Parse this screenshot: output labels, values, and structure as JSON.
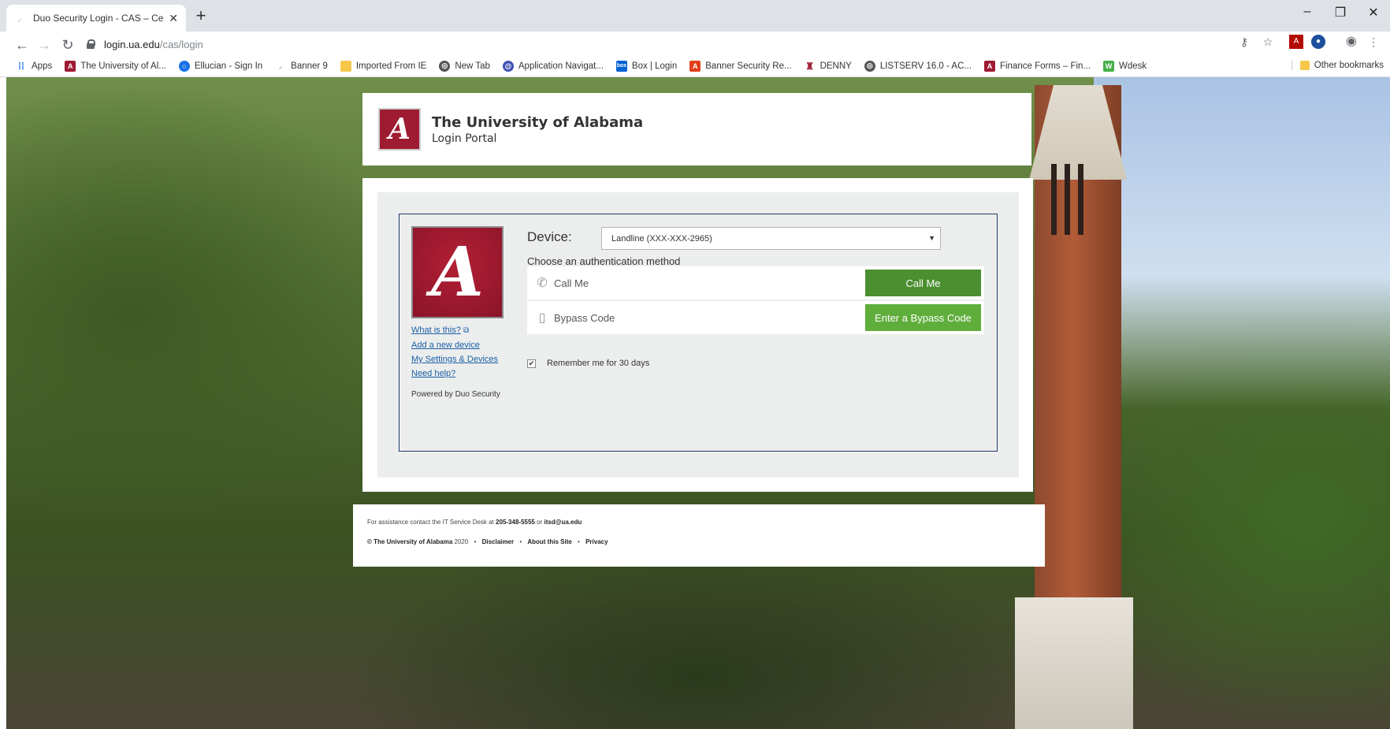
{
  "browser": {
    "tab_title": "Duo Security Login - CAS – Centr",
    "url_host": "login.ua.edu",
    "url_path": "/cas/login",
    "bookmarks": [
      {
        "label": "Apps",
        "icon": "apps-grid-icon",
        "color": "#1a73e8"
      },
      {
        "label": "The University of Al...",
        "icon": "ua-logo-icon",
        "color": "#9e1b32"
      },
      {
        "label": "Ellucian - Sign In",
        "icon": "ellucian-icon",
        "color": "#1a73e8"
      },
      {
        "label": "Banner 9",
        "icon": "banner-icon",
        "color": "#999999"
      },
      {
        "label": "Imported From IE",
        "icon": "folder-icon",
        "color": "#f6c84a"
      },
      {
        "label": "New Tab",
        "icon": "globe-icon",
        "color": "#555555"
      },
      {
        "label": "Application Navigat...",
        "icon": "app-nav-icon",
        "color": "#3f51b5"
      },
      {
        "label": "Box | Login",
        "icon": "box-icon",
        "color": "#0061d5"
      },
      {
        "label": "Banner Security Re...",
        "icon": "banner-security-icon",
        "color": "#e2401c"
      },
      {
        "label": "DENNY",
        "icon": "denny-icon",
        "color": "#a0213a"
      },
      {
        "label": "LISTSERV 16.0 - AC...",
        "icon": "globe-icon",
        "color": "#555555"
      },
      {
        "label": "Finance Forms – Fin...",
        "icon": "ua-logo-icon",
        "color": "#9e1b32"
      },
      {
        "label": "Wdesk",
        "icon": "wdesk-icon",
        "color": "#47b04b"
      }
    ],
    "other_bookmarks": "Other bookmarks"
  },
  "header": {
    "title": "The University of Alabama",
    "subtitle": "Login Portal",
    "logo_glyph": "A"
  },
  "duo": {
    "logo_glyph": "A",
    "links": {
      "what_is_this": "What is this?",
      "add_device": "Add a new device",
      "settings": "My Settings & Devices",
      "help": "Need help?"
    },
    "powered_by": "Powered by Duo Security",
    "device_label": "Device:",
    "device_value": "Landline (XXX-XXX-2965)",
    "choose_label": "Choose an authentication method",
    "methods": [
      {
        "label": "Call Me",
        "button": "Call Me",
        "icon": "phone-icon"
      },
      {
        "label": "Bypass Code",
        "button": "Enter a Bypass Code",
        "icon": "bypass-code-icon"
      }
    ],
    "remember_label": "Remember me for 30 days",
    "remember_checked": true
  },
  "footer": {
    "assist_prefix": "For assistance contact the IT Service Desk at",
    "phone": "205-348-5555",
    "or": "or",
    "email": "itsd@ua.edu",
    "copyright_org": "© The University of Alabama",
    "copyright_year": "2020",
    "links": [
      "Disclaimer",
      "About this Site",
      "Privacy"
    ]
  }
}
